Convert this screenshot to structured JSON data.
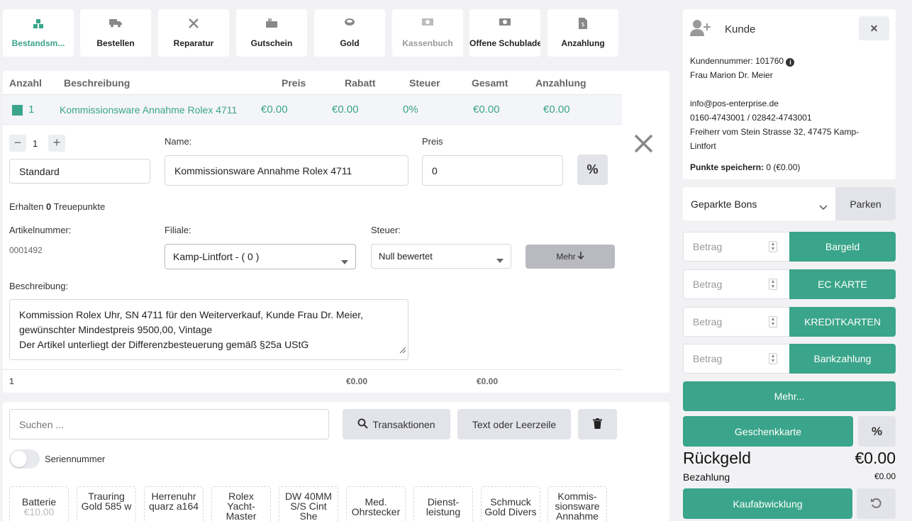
{
  "toolbar": [
    {
      "label": "Bestandsm...",
      "icon": "boxes-icon",
      "state": "active"
    },
    {
      "label": "Bestellen",
      "icon": "truck-icon",
      "state": "normal"
    },
    {
      "label": "Reparatur",
      "icon": "tools-icon",
      "state": "normal"
    },
    {
      "label": "Gutschein",
      "icon": "coins-icon",
      "state": "normal"
    },
    {
      "label": "Gold",
      "icon": "gold-ring-icon",
      "state": "normal"
    },
    {
      "label": "Kassenbuch",
      "icon": "money-bill-icon",
      "state": "disabled"
    },
    {
      "label": "Offene Schublade",
      "icon": "money-bill-icon",
      "state": "normal"
    },
    {
      "label": "Anzahlung",
      "icon": "invoice-dollar-icon",
      "state": "normal"
    }
  ],
  "table": {
    "headers": [
      "Anzahl",
      "Beschreibung",
      "Preis",
      "Rabatt",
      "Steuer",
      "Gesamt",
      "Anzahlung"
    ],
    "row": {
      "qty": "1",
      "description": "Kommissionsware Annahme Rolex 4711",
      "price": "€0.00",
      "discount": "€0.00",
      "tax": "0%",
      "total": "€0.00",
      "deposit": "€0.00"
    },
    "footer": {
      "qty": "1",
      "discount": "€0.00",
      "total": "€0.00"
    }
  },
  "editor": {
    "qty_value": "1",
    "price_type": "Standard",
    "name_label": "Name:",
    "name_value": "Kommissionsware Annahme Rolex 4711",
    "price_label": "Preis",
    "price_value": "0",
    "percent_symbol": "%",
    "loyalty_prefix": "Erhalten",
    "loyalty_points": "0",
    "loyalty_suffix": "Treuepunkte",
    "article_label": "Artikelnummer:",
    "article_value": "0001492",
    "branch_label": "Filiale:",
    "branch_value": "Kamp-Lintfort - ( 0 )",
    "tax_label": "Steuer:",
    "tax_value": "Null bewertet",
    "more_label": "Mehr",
    "desc_label": "Beschreibung:",
    "desc_line1": "Kommission Rolex Uhr, SN 4711 für den Weiterverkauf, Kunde Frau Dr. Meier,",
    "desc_line2": "gewünschter Mindestpreis 9500,00, Vintage",
    "desc_line3": "Der Artikel unterliegt der Differenzbesteuerung gemäß §25a UStG"
  },
  "search": {
    "placeholder": "Suchen ...",
    "transactions_label": "Transaktionen",
    "text_line_label": "Text oder Leerzeile",
    "serial_label": "Seriennummer"
  },
  "tiles": [
    {
      "line1": "Batterie",
      "line2": "€10.00",
      "line3": ""
    },
    {
      "line1": "Trauring",
      "line2": "Gold 585 w",
      "line3": ""
    },
    {
      "line1": "Herrenuhr",
      "line2": "quarz a164",
      "line3": ""
    },
    {
      "line1": "Rolex",
      "line2": "Yacht-",
      "line3": "Master"
    },
    {
      "line1": "DW 40MM",
      "line2": "S/S Cint",
      "line3": "She"
    },
    {
      "line1": "Med.",
      "line2": "Ohrstecker",
      "line3": ""
    },
    {
      "line1": "Dienst-",
      "line2": "leistung",
      "line3": ""
    },
    {
      "line1": "Schmuck",
      "line2": "Gold Divers",
      "line3": ""
    },
    {
      "line1": "Kommis-",
      "line2": "sionsware",
      "line3": "Annahme"
    }
  ],
  "customer": {
    "title": "Kunde",
    "number_label": "Kundennummer:",
    "number": "101760",
    "name": "Frau Marion Dr. Meier",
    "email": "info@pos-enterprise.de",
    "phones": "0160-4743001 / 02842-4743001",
    "address_line1": "Freiherr vom Stein Strasse 32, 47475 Kamp-",
    "address_line2": "Lintfort",
    "points_label": "Punkte speichern:",
    "points_value": "0 (€0.00)"
  },
  "parked": {
    "select_value": "Geparkte Bons",
    "park_label": "Parken"
  },
  "payments": [
    {
      "placeholder": "Betrag",
      "label": "Bargeld"
    },
    {
      "placeholder": "Betrag",
      "label": "EC KARTE"
    },
    {
      "placeholder": "Betrag",
      "label": "KREDITKARTEN"
    },
    {
      "placeholder": "Betrag",
      "label": "Bankzahlung"
    }
  ],
  "more_payments_label": "Mehr...",
  "gift_card_label": "Geschenkkarte",
  "change": {
    "label": "Rückgeld",
    "value": "€0.00"
  },
  "paid": {
    "label": "Bezahlung",
    "value": "€0.00"
  },
  "checkout_label": "Kaufabwicklung",
  "colors": {
    "accent": "#3aa58a",
    "grey_button": "#e3e4ea",
    "background": "#f2f2f5"
  }
}
